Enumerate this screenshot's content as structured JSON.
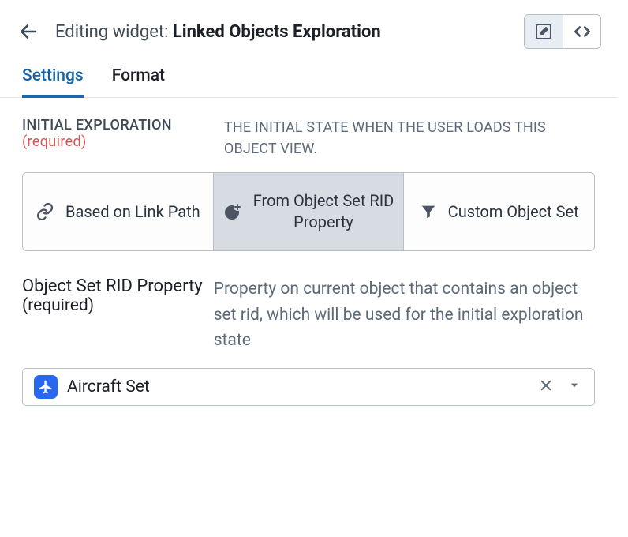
{
  "header": {
    "prefix": "Editing widget:",
    "name": "Linked Objects Exploration"
  },
  "tabs": [
    {
      "label": "Settings",
      "active": true
    },
    {
      "label": "Format",
      "active": false
    }
  ],
  "initial_exploration": {
    "label": "INITIAL EXPLORATION",
    "required_text": "(required)",
    "description": "THE INITIAL STATE WHEN THE USER LOADS THIS OBJECT VIEW.",
    "options": [
      {
        "label": "Based on Link Path",
        "icon": "link",
        "selected": false
      },
      {
        "label": "From Object Set RID Property",
        "icon": "add-circle",
        "selected": true
      },
      {
        "label": "Custom Object Set",
        "icon": "funnel",
        "selected": false
      }
    ]
  },
  "rid_property": {
    "label": "Object Set RID Property",
    "required_text": "(required)",
    "description": "Property on current object that contains an object set rid, which will be used for the initial exploration state",
    "selected_value": "Aircraft Set",
    "selected_icon": "plane"
  }
}
